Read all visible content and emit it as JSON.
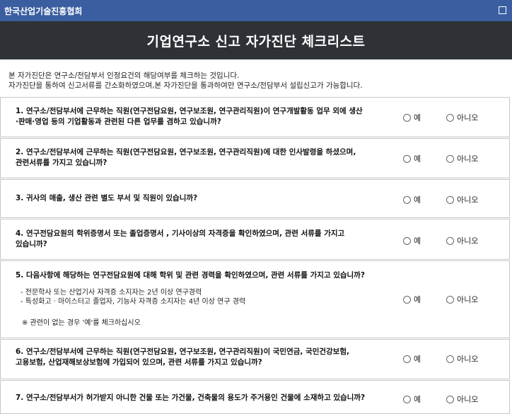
{
  "window": {
    "title": "한국산업기술진흥협회"
  },
  "banner": {
    "title": "기업연구소 신고 자가진단 체크리스트"
  },
  "intro": {
    "line1": "본 자가진단은 연구소/전담부서 인정요건의 해당여부를 체크하는 것입니다.",
    "line2": "자가진단을 통하여 신고서류를 간소화하였으며,본 자가진단을 통과하여만 연구소/전담부서 설립신고가 가능합니다."
  },
  "options": {
    "yes": "예",
    "no": "아니오"
  },
  "questions": [
    {
      "line1": "1. 연구소/전담부서에 근무하는 직원(연구전담요원, 연구보조원, 연구관리직원)이 연구개발활동 업무 외에 생산",
      "line2": "·판매·영업 등의 기업활동과 관련된 다른 업무를 겸하고 있습니까?"
    },
    {
      "line1": "2. 연구소/전담부서에 근무하는 직원(연구전담요원, 연구보조원, 연구관리직원)에 대한 인사발령을 하셨으며,",
      "line2": "관련서류를 가지고 있습니까?"
    },
    {
      "line1": "3. 귀사의 매출, 생산 관련 별도 부서 및 직원이 있습니까?",
      "line2": ""
    },
    {
      "line1": "4. 연구전담요원의 학위증명서 또는 졸업증명서 , 기사이상의 자격증을 확인하였으며, 관련 서류를 가지고",
      "line2": "있습니까?"
    },
    {
      "line1": "5. 다음사항에 해당하는 연구전담요원에 대해 학위 및 관련 경력을 확인하였으며, 관련 서류를 가지고 있습니까?",
      "line2": "",
      "sub1": "- 전문학사 또는 산업기사 자격증 소지자는 2년 이상 연구경력",
      "sub2": "- 특성화고 · 마이스터고 졸업자, 기능사 자격증 소지자는 4년 이상 연구 경력",
      "note": "※ 관련이 없는 경우 '예'를 체크하십시오"
    },
    {
      "line1": "6. 연구소/전담부서에 근무하는 직원(연구전담요원, 연구보조원, 연구관리직원)이 국민연금, 국민건강보험,",
      "line2": "고용보험, 산업재해보상보험에 가입되어 있으며, 관련 서류를 가지고 있습니까?"
    },
    {
      "line1": "7. 연구소/전담부서가 허가받지 아니한 건물 또는 가건물, 건축물의 용도가 주거용인 건물에 소재하고 있습니까?",
      "line2": ""
    }
  ]
}
